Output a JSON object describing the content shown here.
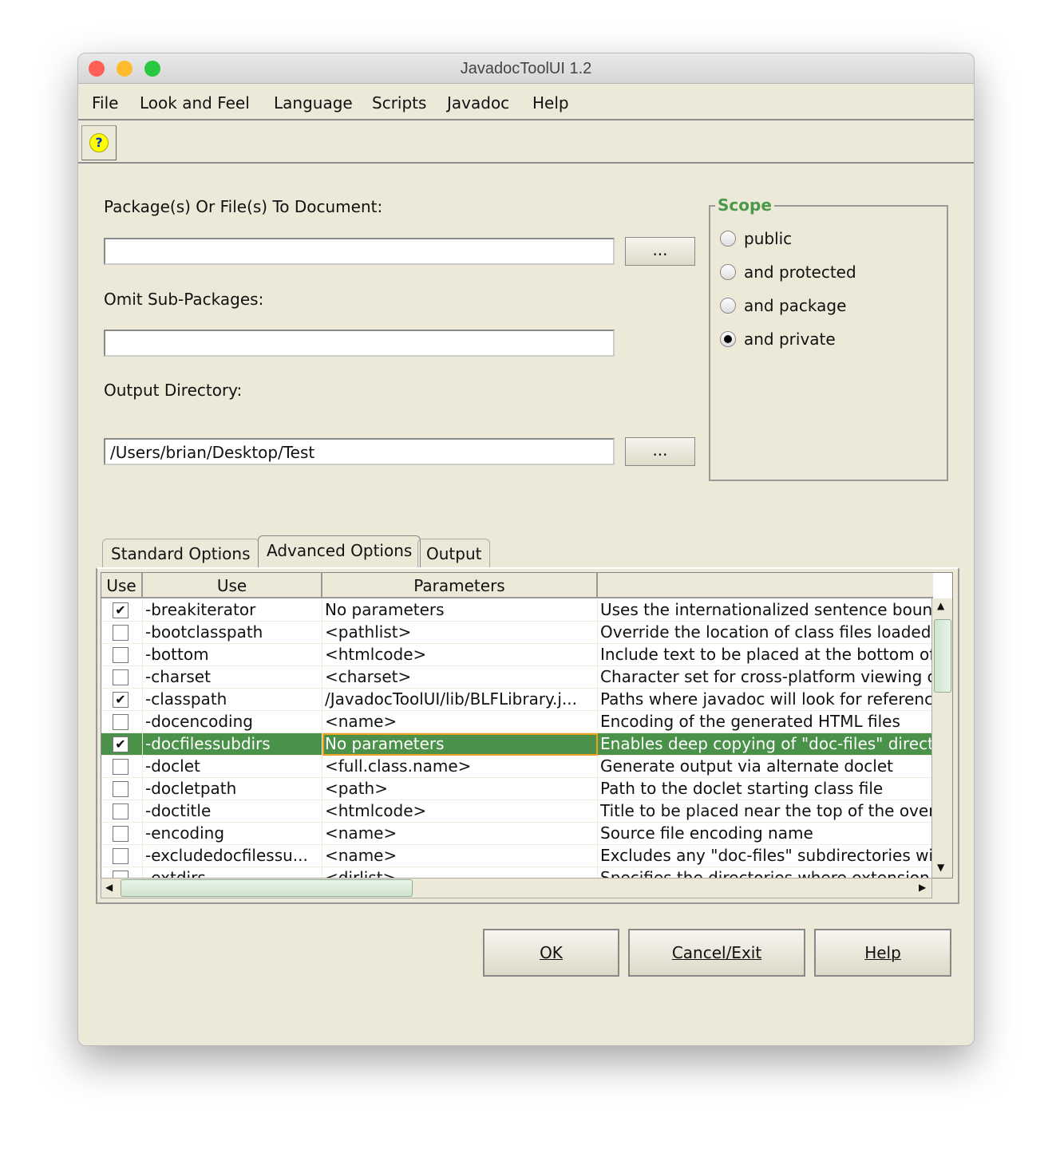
{
  "window": {
    "title": "JavadocToolUI 1.2"
  },
  "menu": [
    "File",
    "Look and Feel",
    "Language",
    "Scripts",
    "Javadoc",
    "Help"
  ],
  "toolbar": {
    "help_icon": "help-bubble-icon",
    "help_glyph": "?"
  },
  "form": {
    "packages_label": "Package(s) Or File(s) To Document:",
    "packages_value": "",
    "omit_label": "Omit Sub-Packages:",
    "omit_value": "",
    "output_label": "Output Directory:",
    "output_value": "/Users/brian/Desktop/Test",
    "browse_label": "..."
  },
  "scope": {
    "title": "Scope",
    "options": [
      {
        "label": "public",
        "selected": false
      },
      {
        "label": "and protected",
        "selected": false
      },
      {
        "label": "and package",
        "selected": false
      },
      {
        "label": "and private",
        "selected": true
      }
    ]
  },
  "tabs": [
    {
      "label": "Standard Options",
      "active": false
    },
    {
      "label": "Advanced Options",
      "active": true
    },
    {
      "label": "Output",
      "active": false
    }
  ],
  "table": {
    "headers": [
      "Use",
      "Use",
      "Parameters",
      ""
    ],
    "rows": [
      {
        "checked": true,
        "option": "-breakiterator",
        "params": "No parameters",
        "desc": "Uses the internationalized sentence bound"
      },
      {
        "checked": false,
        "option": "-bootclasspath",
        "params": "<pathlist>",
        "desc": "Override the location of class files loaded"
      },
      {
        "checked": false,
        "option": "-bottom",
        "params": "<htmlcode>",
        "desc": "Include text to be placed at the bottom of"
      },
      {
        "checked": false,
        "option": "-charset",
        "params": "<charset>",
        "desc": "Character set for cross-platform viewing o"
      },
      {
        "checked": true,
        "option": "-classpath",
        "params": "/JavadocToolUI/lib/BLFLibrary.j...",
        "desc": "Paths where javadoc will look for referenc"
      },
      {
        "checked": false,
        "option": "-docencoding",
        "params": "<name>",
        "desc": "Encoding of the generated HTML files"
      },
      {
        "checked": true,
        "option": "-docfilessubdirs",
        "params": "No parameters",
        "desc": "Enables deep copying of \"doc-files\" direct",
        "selected": true
      },
      {
        "checked": false,
        "option": "-doclet",
        "params": "<full.class.name>",
        "desc": "Generate output via alternate doclet"
      },
      {
        "checked": false,
        "option": "-docletpath",
        "params": "<path>",
        "desc": "Path to the doclet starting class file"
      },
      {
        "checked": false,
        "option": "-doctitle",
        "params": "<htmlcode>",
        "desc": "Title to be placed near the top of the over"
      },
      {
        "checked": false,
        "option": "-encoding",
        "params": "<name>",
        "desc": "Source file encoding name"
      },
      {
        "checked": false,
        "option": "-excludedocfilessu...",
        "params": "<name>",
        "desc": "Excludes any \"doc-files\" subdirectories wi"
      },
      {
        "checked": false,
        "option": "-extdirs",
        "params": "<dirlist>",
        "desc": "Specifies the directories where extension"
      }
    ]
  },
  "buttons": {
    "ok": "OK",
    "cancel": "Cancel/Exit",
    "help": "Help"
  },
  "colors": {
    "accent": "#4a9a4a",
    "selection": "#4a914a",
    "background": "#ECE9D8"
  }
}
